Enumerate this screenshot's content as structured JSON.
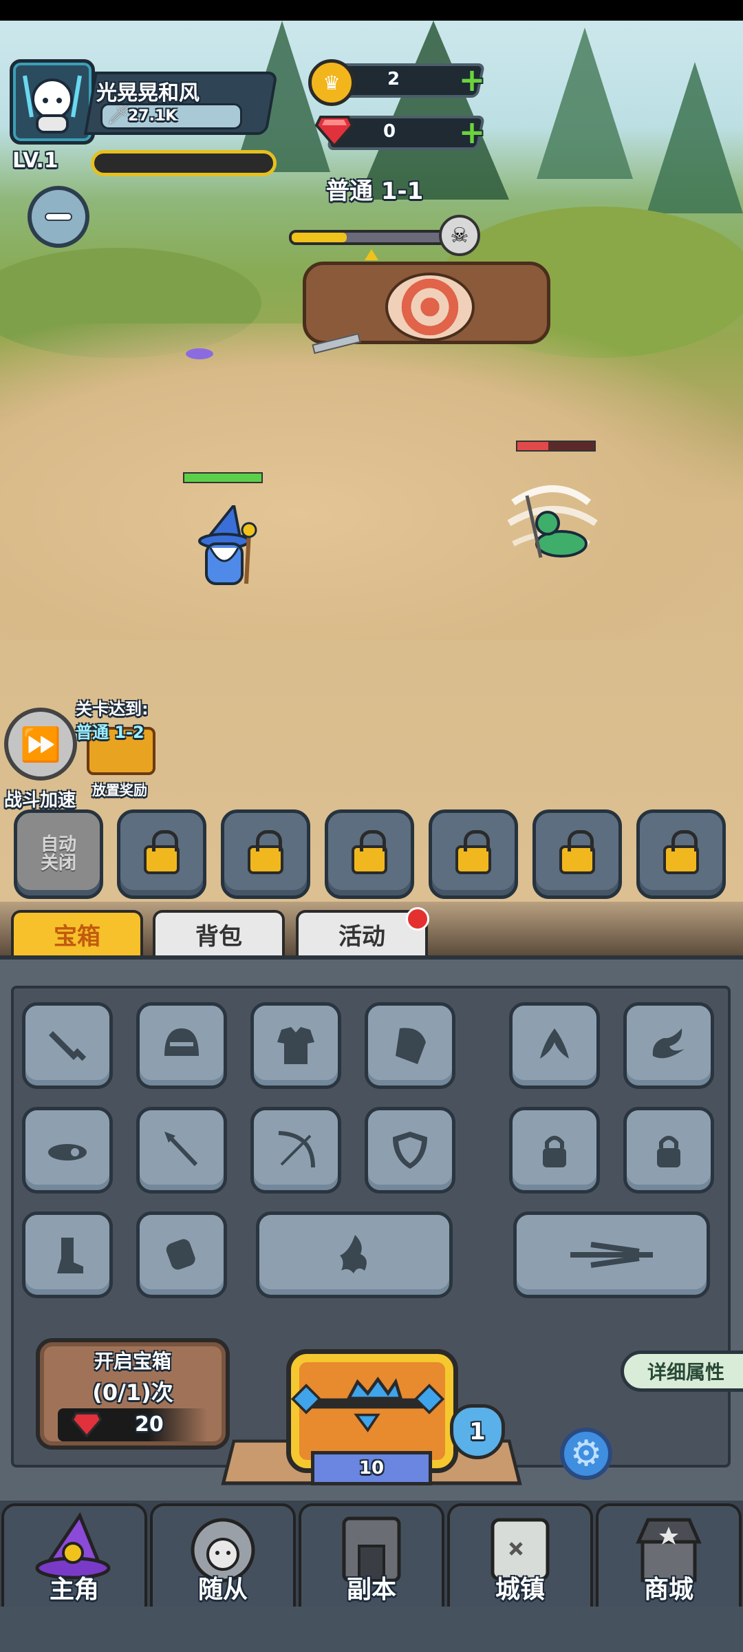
{
  "player": {
    "name": "光晃晃和风",
    "power": "27.1K",
    "level": "LV.1"
  },
  "resources": {
    "gold": "2",
    "gems": "0"
  },
  "stage": {
    "title": "普通 1-1",
    "progress_fraction": 0.33
  },
  "speedup": {
    "label": "战斗加速"
  },
  "idle_reward": {
    "reached_label": "关卡达到:",
    "reached_stage": "普通 1-2",
    "label": "放置奖励"
  },
  "skill_slots": {
    "auto_label_line1": "自动",
    "auto_label_line2": "关闭"
  },
  "tabs": [
    {
      "label": "宝箱"
    },
    {
      "label": "背包"
    },
    {
      "label": "活动"
    }
  ],
  "chest": {
    "open_title": "开启宝箱",
    "open_count": "(0/1)次",
    "cost": "20",
    "chest_count": "10",
    "chest_level": "1"
  },
  "detail_button": "详细属性",
  "nav": [
    {
      "label": "主角"
    },
    {
      "label": "随从"
    },
    {
      "label": "副本"
    },
    {
      "label": "城镇"
    },
    {
      "label": "商城"
    }
  ],
  "colors": {
    "accent": "#f6c12a",
    "panel": "#5b6570",
    "hp_green": "#5ccf4a",
    "hp_red": "#e14a4a"
  }
}
